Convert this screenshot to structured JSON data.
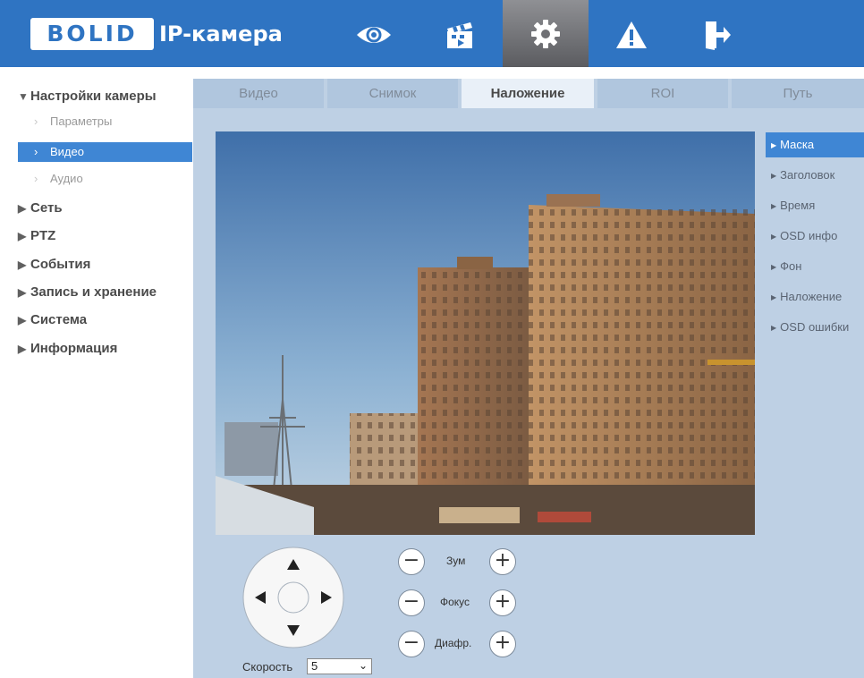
{
  "header": {
    "logo_text": "BOLID",
    "title": "IP-камера",
    "nav_icons": [
      "eye-icon",
      "clapperboard-icon",
      "gear-icon",
      "warning-icon",
      "logout-icon"
    ],
    "active_icon": "gear-icon",
    "background": "#2f74c2"
  },
  "sidebar": {
    "groups": [
      {
        "label": "Настройки камеры",
        "expanded": true,
        "items": [
          {
            "label": "Параметры"
          },
          {
            "label": "Видео",
            "selected": true
          },
          {
            "label": "Аудио"
          }
        ]
      },
      {
        "label": "Сеть"
      },
      {
        "label": "PTZ"
      },
      {
        "label": "События"
      },
      {
        "label": "Запись и хранение"
      },
      {
        "label": "Система"
      },
      {
        "label": "Информация"
      }
    ]
  },
  "tabs": [
    {
      "label": "Видео"
    },
    {
      "label": "Снимок"
    },
    {
      "label": "Наложение",
      "active": true
    },
    {
      "label": "ROI"
    },
    {
      "label": "Путь"
    }
  ],
  "right_menu": [
    {
      "label": "Маска",
      "active": true
    },
    {
      "label": "Заголовок"
    },
    {
      "label": "Время"
    },
    {
      "label": "OSD инфо"
    },
    {
      "label": "Фон"
    },
    {
      "label": "Наложение"
    },
    {
      "label": "OSD ошибки"
    }
  ],
  "ptz": {
    "zoom_label": "Зум",
    "focus_label": "Фокус",
    "iris_label": "Диафр.",
    "speed_label": "Скорость",
    "speed_value": "5",
    "minus_symbol": "−",
    "plus_symbol": "+"
  },
  "colors": {
    "accent": "#3f86d4",
    "panel": "#bed0e4"
  }
}
